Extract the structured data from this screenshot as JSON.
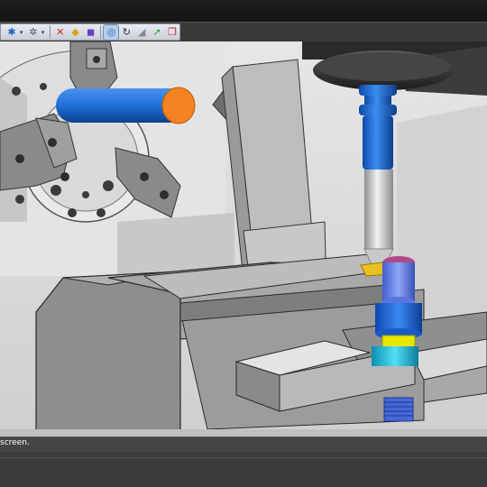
{
  "app": {
    "window_title": "",
    "accent": "#f58220",
    "background": "#2b2b2b"
  },
  "toolbar": {
    "buttons": [
      {
        "icon": "star-snap-icon",
        "glyph": "✱",
        "color": "#1a66c8",
        "has_dropdown": true
      },
      {
        "icon": "star-alt-snap-icon",
        "glyph": "✲",
        "color": "#555555",
        "has_dropdown": true
      },
      {
        "icon": "curve-tool-icon",
        "glyph": "✕",
        "color": "#d82020"
      },
      {
        "icon": "solid-tool-icon",
        "glyph": "◆",
        "color": "#e0a000"
      },
      {
        "icon": "cube-tool-icon",
        "glyph": "◼",
        "color": "#6a3fc0"
      },
      {
        "icon": "orbit-view-icon",
        "glyph": "◎",
        "color": "#1a66c8",
        "active": true
      },
      {
        "icon": "rotate-icon",
        "glyph": "↻",
        "color": "#333333"
      },
      {
        "icon": "shade-icon",
        "glyph": "◢",
        "color": "#888888"
      },
      {
        "icon": "arrow-green-icon",
        "glyph": "➚",
        "color": "#2a9d2a"
      },
      {
        "icon": "box-red-icon",
        "glyph": "❒",
        "color": "#c82020"
      }
    ]
  },
  "viewport": {
    "label": "3D machine simulation viewport",
    "colors": {
      "stock": "#1f6fd8",
      "stock_face": "#f58220",
      "chuck": "#7a7a7a",
      "vise": "#8a8a8a",
      "tool_holder": "#1f6fd8",
      "tool_shank": "#d8d8d8",
      "tool_tip": "#e8c020",
      "workpiece": "#5f7fe8",
      "fixture_yellow": "#e6e600",
      "fixture_cyan": "#20c8e0",
      "spindle": "#3a3a3a"
    }
  },
  "status": {
    "text": "screen."
  }
}
